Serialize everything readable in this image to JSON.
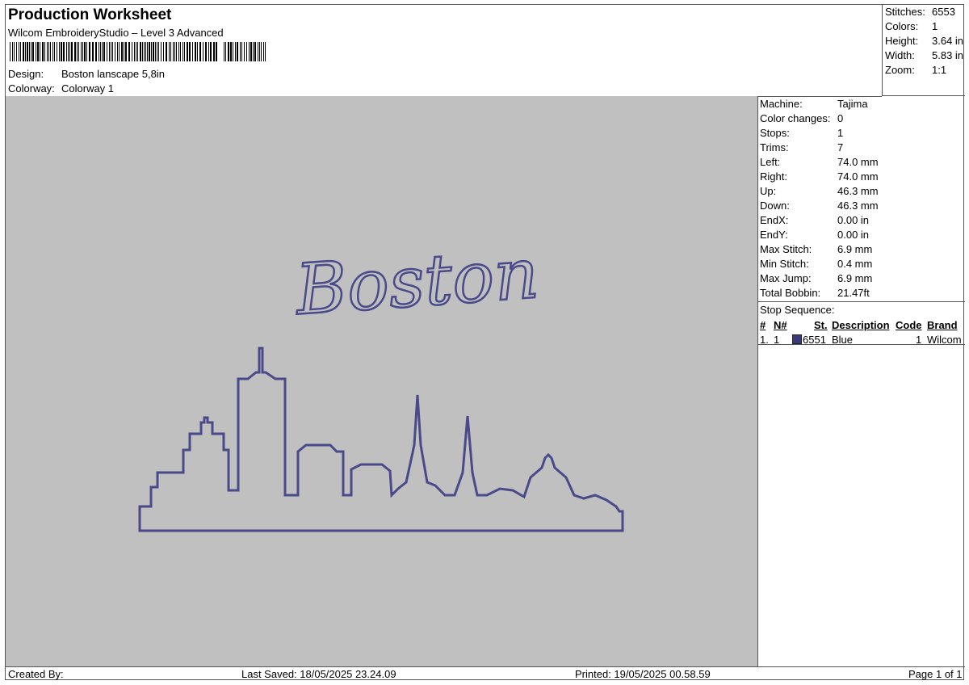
{
  "header": {
    "title": "Production Worksheet",
    "software": "Wilcom EmbroideryStudio – Level 3 Advanced",
    "design_label": "Design:",
    "design_value": "Boston lanscape 5,8in",
    "colorway_label": "Colorway:",
    "colorway_value": "Colorway 1"
  },
  "summary": {
    "stitches_label": "Stitches:",
    "stitches_value": "6553",
    "colors_label": "Colors:",
    "colors_value": "1",
    "height_label": "Height:",
    "height_value": "3.64 in",
    "width_label": "Width:",
    "width_value": "5.83 in",
    "zoom_label": "Zoom:",
    "zoom_value": "1:1"
  },
  "info": {
    "machine_label": "Machine:",
    "machine_value": "Tajima",
    "color_changes_label": "Color changes:",
    "color_changes_value": "0",
    "stops_label": "Stops:",
    "stops_value": "1",
    "trims_label": "Trims:",
    "trims_value": "7",
    "left_label": "Left:",
    "left_value": "74.0 mm",
    "right_label": "Right:",
    "right_value": "74.0 mm",
    "up_label": "Up:",
    "up_value": "46.3 mm",
    "down_label": "Down:",
    "down_value": "46.3 mm",
    "endx_label": "EndX:",
    "endx_value": "0.00 in",
    "endy_label": "EndY:",
    "endy_value": "0.00 in",
    "max_stitch_label": "Max Stitch:",
    "max_stitch_value": "6.9 mm",
    "min_stitch_label": "Min Stitch:",
    "min_stitch_value": "0.4 mm",
    "max_jump_label": "Max Jump:",
    "max_jump_value": "6.9 mm",
    "total_bobbin_label": "Total Bobbin:",
    "total_bobbin_value": "21.47ft"
  },
  "stop_sequence": {
    "title": "Stop Sequence:",
    "columns": [
      "#",
      "N#",
      "St.",
      "Description",
      "Code",
      "Brand"
    ],
    "rows": [
      {
        "num": "1.",
        "n": "1",
        "st": "6551",
        "description": "Blue",
        "code": "1",
        "brand": "Wilcom",
        "color": "#3a3a7a"
      }
    ]
  },
  "design_preview": {
    "text": "Boston",
    "thread_color": "#4a4a8a",
    "background_color": "#c0c0c0"
  },
  "footer": {
    "created_by": "Created By:",
    "last_saved": "Last Saved: 18/05/2025 23.24.09",
    "printed": "Printed: 19/05/2025 00.58.59",
    "page": "Page 1 of 1"
  }
}
